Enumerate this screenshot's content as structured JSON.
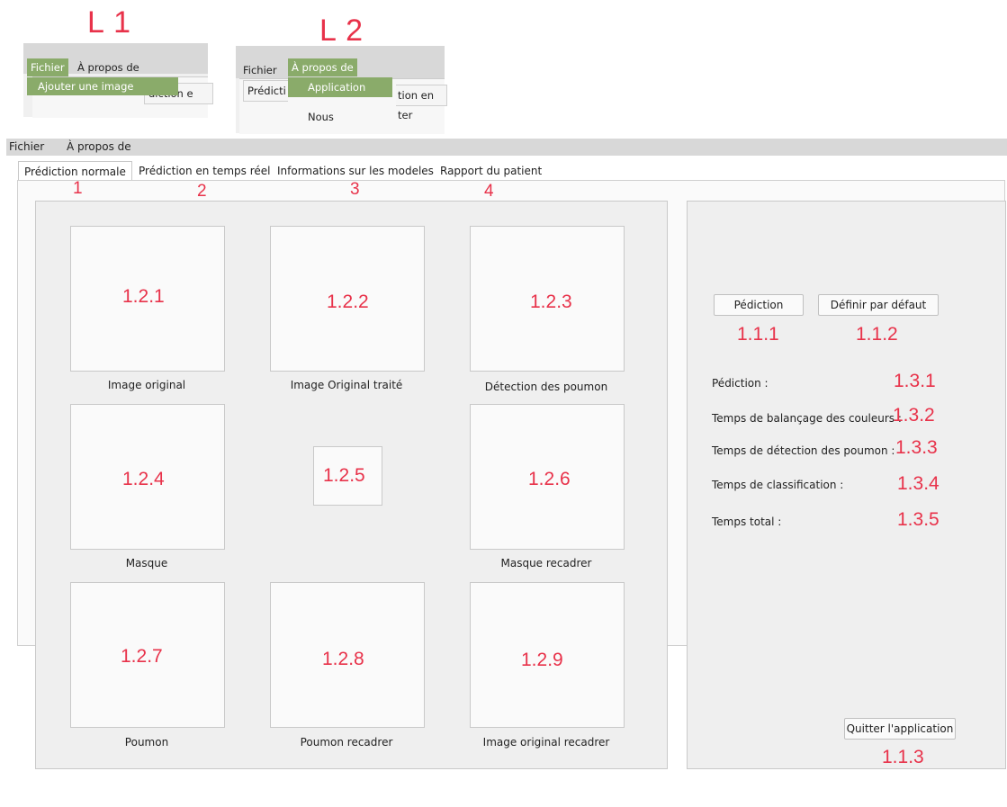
{
  "labels": {
    "l1": "L 1",
    "l2": "L 2"
  },
  "snippet_l1": {
    "menu": [
      "Fichier",
      "À propos de"
    ],
    "dropdown_item": "Ajouter une image",
    "tab_fragment": "diction e"
  },
  "snippet_l2": {
    "menu": [
      "Fichier",
      "À propos de"
    ],
    "dropdown_items": [
      "Application",
      "Nous"
    ],
    "tab_fragment_left": "Prédicti",
    "tab_fragment_right": "tion en ter"
  },
  "menubar": [
    "Fichier",
    "À propos de"
  ],
  "tabs": [
    {
      "label": "Prédiction normale",
      "number": "1"
    },
    {
      "label": "Prédiction en temps réel",
      "number": "2"
    },
    {
      "label": "Informations sur les modeles",
      "number": "3"
    },
    {
      "label": "Rapport du patient",
      "number": "4"
    }
  ],
  "images": [
    {
      "id": "1.2.1",
      "caption": "Image original"
    },
    {
      "id": "1.2.2",
      "caption": "Image Original traité"
    },
    {
      "id": "1.2.3",
      "caption": "Détection des poumon"
    },
    {
      "id": "1.2.4",
      "caption": "Masque"
    },
    {
      "id": "1.2.5",
      "caption": ""
    },
    {
      "id": "1.2.6",
      "caption": "Masque recadrer"
    },
    {
      "id": "1.2.7",
      "caption": "Poumon"
    },
    {
      "id": "1.2.8",
      "caption": "Poumon recadrer"
    },
    {
      "id": "1.2.9",
      "caption": "Image original recadrer"
    }
  ],
  "buttons": {
    "predict": {
      "label": "Pédiction",
      "id": "1.1.1"
    },
    "default": {
      "label": "Définir par défaut",
      "id": "1.1.2"
    },
    "quit": {
      "label": "Quitter l'application",
      "id": "1.1.3"
    }
  },
  "results": [
    {
      "label": "Pédiction :",
      "id": "1.3.1"
    },
    {
      "label": "Temps de balançage des couleurs :",
      "id": "1.3.2"
    },
    {
      "label": "Temps de détection des poumon :",
      "id": "1.3.3"
    },
    {
      "label": "Temps de classification :",
      "id": "1.3.4"
    },
    {
      "label": "Temps total :",
      "id": "1.3.5"
    }
  ],
  "colors": {
    "annotation": "#e8324a",
    "menu_highlight": "#8aab6a"
  }
}
